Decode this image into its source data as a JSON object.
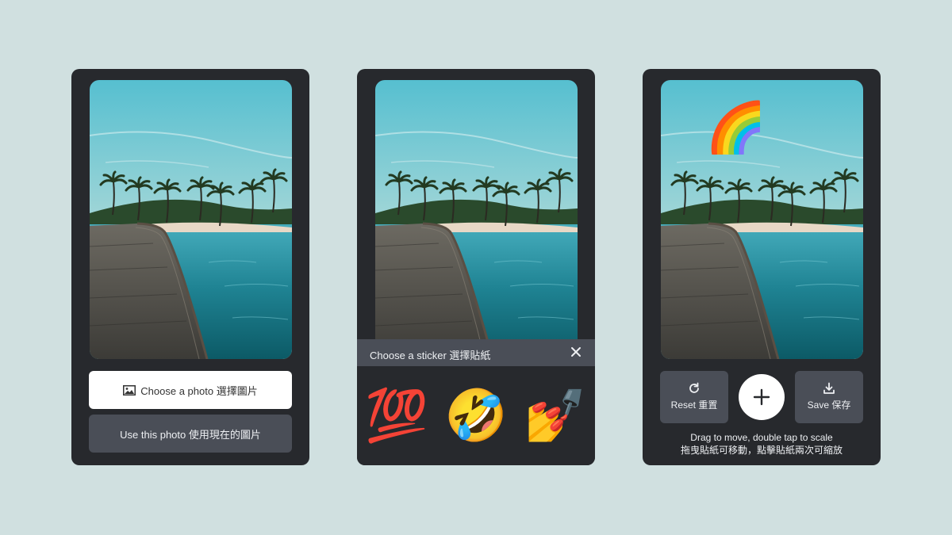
{
  "colors": {
    "background": "#d0e0e0",
    "panel": "#27292d",
    "button_secondary": "#4a4e57",
    "button_primary": "#ffffff",
    "text_light": "#eef0f3"
  },
  "panel_choose": {
    "choose_button_label": "Choose a photo 選擇圖片",
    "choose_button_icon": "image-icon",
    "use_button_label": "Use this photo 使用現在的圖片"
  },
  "panel_stickers": {
    "sheet_title": "Choose a sticker 選擇貼紙",
    "close_icon": "close-icon",
    "stickers": [
      "💯",
      "🤣",
      "💅"
    ]
  },
  "panel_edit": {
    "placed_sticker": "🌈",
    "reset_label": "Reset 重置",
    "reset_icon": "refresh-icon",
    "add_icon": "plus-icon",
    "save_label": "Save 保存",
    "save_icon": "download-icon",
    "hint_line1": "Drag to move, double tap to scale",
    "hint_line2": "拖曳貼紙可移動，點擊貼紙兩次可縮放"
  }
}
